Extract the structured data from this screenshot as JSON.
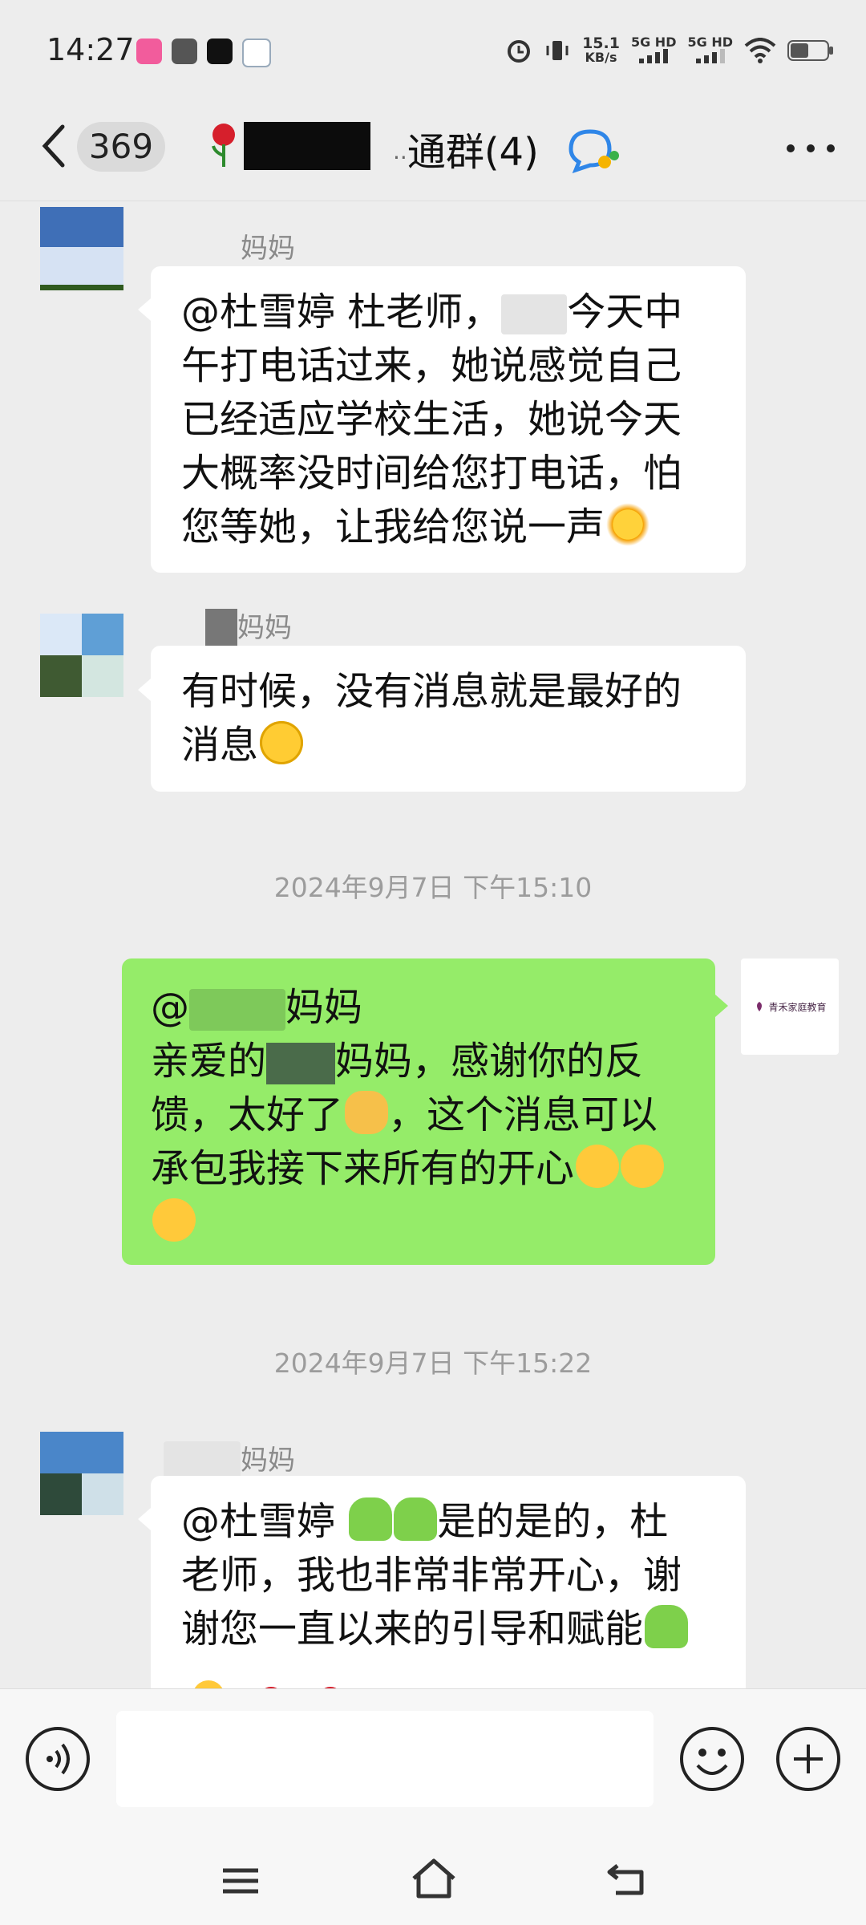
{
  "status_bar": {
    "time": "14:27",
    "net_speed_value": "15.1",
    "net_speed_unit": "KB/s",
    "sim1": "5G HD",
    "sim2": "5G HD"
  },
  "header": {
    "unread_count": "369",
    "title_suffix": "通群(4)",
    "title_ellipsis": "··"
  },
  "messages": [
    {
      "sender": "妈妈",
      "lines": [
        "@杜雪婷  杜老师，",
        "今天中",
        "午打电话过来，她说感觉自己",
        "已经适应学校生活，她说今天",
        "大概率没时间给您打电话，怕",
        "您等她，让我给您说一声"
      ],
      "emoji": "sun"
    },
    {
      "sender": "妈妈",
      "lines": [
        "有时候，没有消息就是最好的",
        "消息"
      ],
      "emoji": "smirk"
    },
    {
      "timestamp": "2024年9月7日 下午15:10"
    },
    {
      "sender_self": true,
      "lines": [
        "@",
        "妈妈",
        "亲爱的",
        "妈妈，感谢你的反",
        "馈，太好了",
        "，这个消息可以",
        "承包我接下来所有的开心"
      ],
      "avatar_text": "青禾家庭教育"
    },
    {
      "timestamp": "2024年9月7日 下午15:22"
    },
    {
      "sender": "妈妈",
      "lines": [
        "@杜雪婷 ",
        "是的是的，杜",
        "老师，我也非常非常开心，谢",
        "谢您一直以来的引导和赋能"
      ]
    }
  ],
  "input": {
    "value": "",
    "placeholder": ""
  },
  "icons": {
    "back": "chevron-left-icon",
    "more": "more-icon",
    "voice": "voice-icon",
    "emoji": "emoji-icon",
    "plus": "plus-icon",
    "nav_menu": "menu-icon",
    "nav_home": "home-icon",
    "nav_back": "back-icon"
  },
  "colors": {
    "background": "#ededed",
    "self_bubble": "#95ec69",
    "other_bubble": "#ffffff",
    "timestamp": "#9c9c9c"
  }
}
